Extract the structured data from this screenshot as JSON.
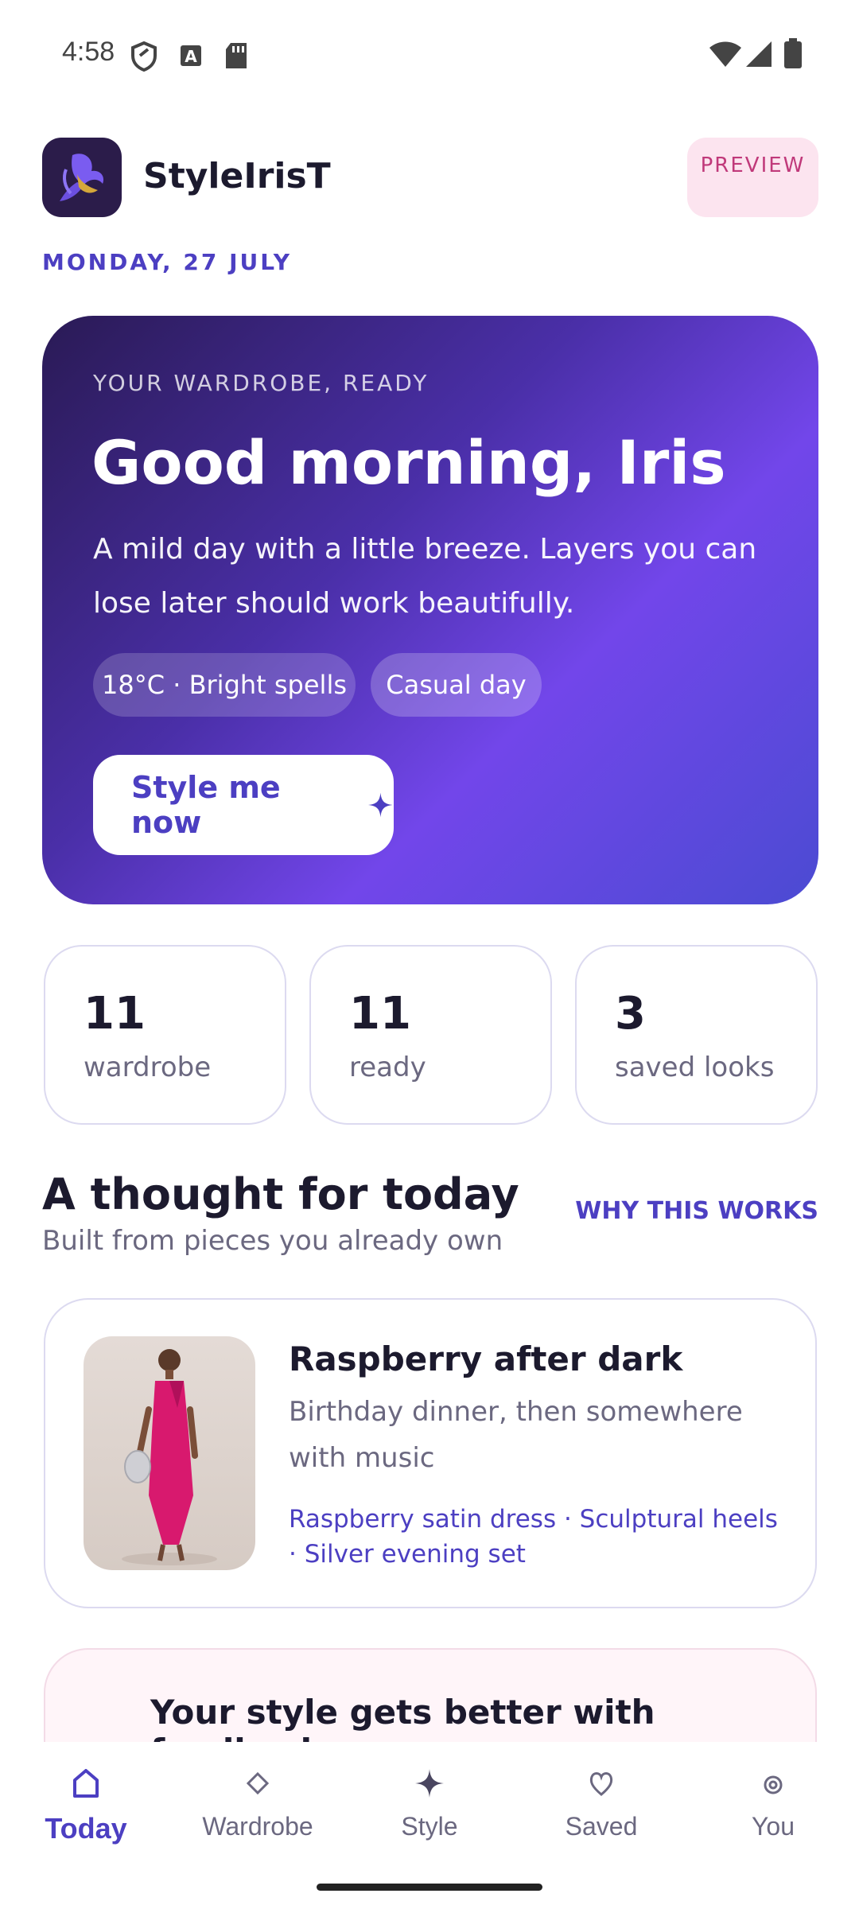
{
  "status_bar": {
    "time": "4:58"
  },
  "header": {
    "app_name": "StyleIrisT",
    "preview_badge": "PREVIEW",
    "date": "MONDAY, 27 JULY"
  },
  "hero": {
    "overline": "YOUR WARDROBE, READY",
    "title": "Good morning, Iris",
    "description": "A mild day with a little breeze. Layers you can lose later should work beautifully.",
    "chips": [
      "18°C · Bright spells",
      "Casual day"
    ],
    "cta_label": "Style me now",
    "cta_icon": "sparkle-icon"
  },
  "stats": [
    {
      "value": "11",
      "label": "wardrobe"
    },
    {
      "value": "11",
      "label": "ready"
    },
    {
      "value": "3",
      "label": "saved looks"
    }
  ],
  "section": {
    "title": "A thought for today",
    "subtitle": "Built from pieces you already own",
    "link": "WHY THIS WORKS"
  },
  "look": {
    "title": "Raspberry after dark",
    "description": "Birthday dinner, then somewhere with music",
    "items": "Raspberry satin dress · Sculptural heels · Silver evening set"
  },
  "feedback": {
    "title": "Your style gets better with feedback"
  },
  "nav": {
    "items": [
      {
        "label": "Today",
        "icon": "home-icon",
        "active": true
      },
      {
        "label": "Wardrobe",
        "icon": "diamond-icon",
        "active": false
      },
      {
        "label": "Style",
        "icon": "sparkle-icon",
        "active": false
      },
      {
        "label": "Saved",
        "icon": "heart-icon",
        "active": false
      },
      {
        "label": "You",
        "icon": "profile-icon",
        "active": false
      }
    ]
  },
  "colors": {
    "accent": "#4c3fc2",
    "hero_start": "#2a1a55",
    "hero_end": "#7246ea",
    "badge_bg": "#fce4ef",
    "badge_text": "#c0397a"
  }
}
